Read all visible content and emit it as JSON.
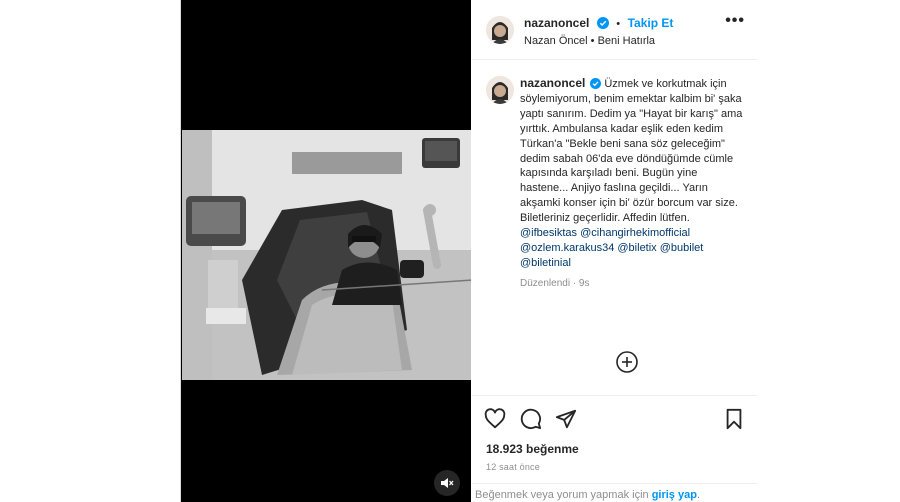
{
  "post": {
    "header": {
      "username": "nazanoncel",
      "follow_label": "Takip Et",
      "separator": "•",
      "subtitle_name": "Nazan Öncel",
      "subtitle_sep": "•",
      "subtitle_audio": "Beni Hatırla",
      "more_label": "•••"
    },
    "caption": {
      "username": "nazanoncel",
      "text": "Üzmek ve korkutmak için söylemiyorum, benim emektar kalbim bi' şaka yaptı sanırım. Dedim ya \"Hayat bir karış\" ama yırttık. Ambulansa kadar eşlik eden kedim Türkan'a \"Bekle beni sana söz geleceğim\" dedim sabah 06'da eve döndüğümde cümle kapısında karşıladı beni. Bugün yine hastene... Anjiyo faslına geçildi... Yarın akşamki konser için bi' özür borcum var size. Biletleriniz geçerlidir. Affedin lütfen.",
      "mentions": [
        "@ifbesiktas",
        "@cihangirhekimofficial",
        "@ozlem.karakus34",
        "@biletix",
        "@bubilet",
        "@biletinial"
      ],
      "edited": "Düzenlendi · 9s"
    },
    "likes": "18.923 beğenme",
    "time": "12 saat önce",
    "footer": {
      "prefix": "Beğenmek veya yorum yapmak için ",
      "login": "giriş yap",
      "suffix": "."
    }
  },
  "icons": {
    "verified": "verified-badge-icon",
    "like": "heart-icon",
    "comment": "comment-icon",
    "share": "share-icon",
    "save": "bookmark-icon",
    "more": "more-options-icon",
    "plus": "plus-circle-icon",
    "mute": "speaker-muted-icon"
  },
  "colors": {
    "link": "#0095f6",
    "mention": "#00376b",
    "muted": "#8e8e8e",
    "text": "#262626"
  }
}
